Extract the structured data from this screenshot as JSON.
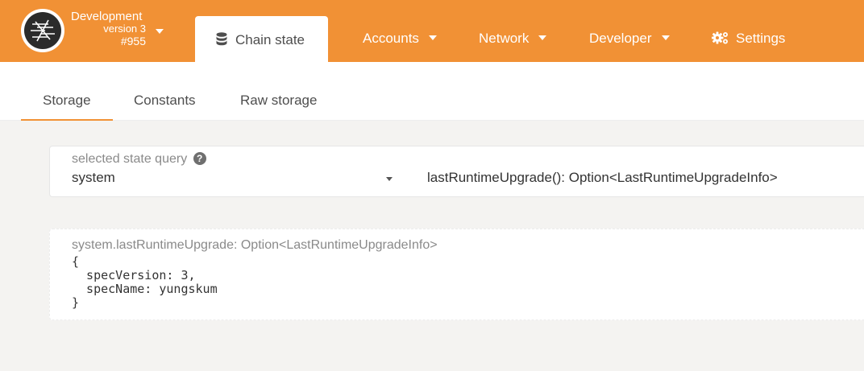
{
  "chain": {
    "name": "Development",
    "version": "version 3",
    "block": "#955"
  },
  "nav": {
    "active_tab": "Chain state",
    "items": [
      {
        "label": "Accounts"
      },
      {
        "label": "Network"
      },
      {
        "label": "Developer"
      },
      {
        "label": "Settings"
      }
    ]
  },
  "subtabs": [
    {
      "label": "Storage",
      "active": true
    },
    {
      "label": "Constants"
    },
    {
      "label": "Raw storage"
    }
  ],
  "query": {
    "label": "selected state query",
    "help": "?",
    "module": "system",
    "method": "lastRuntimeUpgrade(): Option<LastRuntimeUpgradeInfo>"
  },
  "result": {
    "label": "system.lastRuntimeUpgrade: Option<LastRuntimeUpgradeInfo>",
    "value": "{\n  specVersion: 3,\n  specName: yungskum\n}"
  },
  "colors": {
    "accent": "#f19135",
    "background": "#f4f3f1"
  },
  "icons": [
    "substrate-logo-icon",
    "database-icon",
    "chevron-down-icon",
    "gears-icon",
    "question-circle-icon"
  ]
}
